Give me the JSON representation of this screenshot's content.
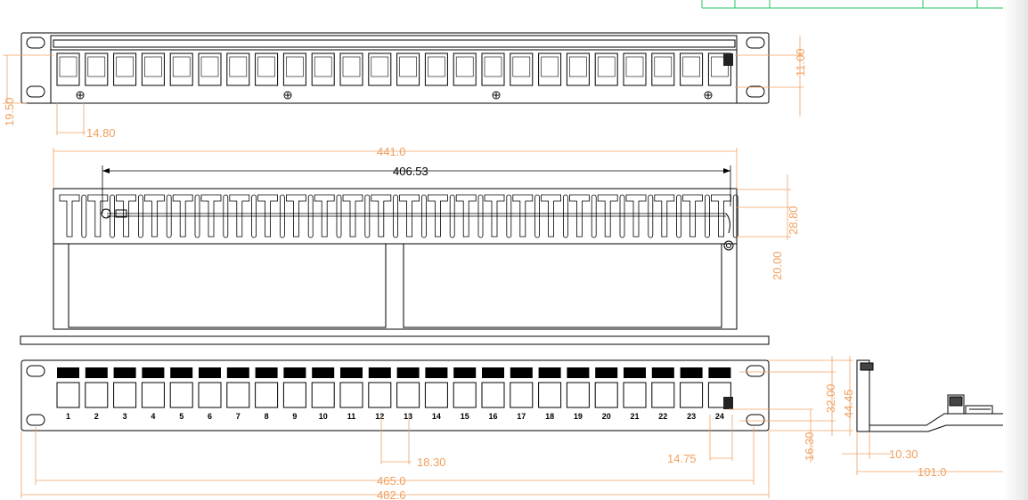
{
  "dimensions": {
    "top_view": {
      "left_height": "19.50",
      "port_pitch": "14.80",
      "right_height": "11.00"
    },
    "rear_view": {
      "overall_width": "441.0",
      "screw_span": "406.53",
      "top_offset": "28.80",
      "lower_offset": "20.00"
    },
    "front_view": {
      "height_total": "44.45",
      "height_inner": "32.00",
      "bottom_offset": "16.30",
      "port_pitch": "18.30",
      "edge_offset": "14.75",
      "inner_width": "465.0",
      "overall_width": "482.6"
    },
    "side_view": {
      "depth_small": "10.30",
      "depth_total": "101.0"
    }
  },
  "port_numbers": [
    "1",
    "2",
    "3",
    "4",
    "5",
    "6",
    "7",
    "8",
    "9",
    "10",
    "11",
    "12",
    "13",
    "14",
    "15",
    "16",
    "17",
    "18",
    "19",
    "20",
    "21",
    "22",
    "23",
    "24"
  ],
  "colors": {
    "outline": "#000000",
    "dimension": "#f0a060",
    "table_border": "#22c55e"
  }
}
